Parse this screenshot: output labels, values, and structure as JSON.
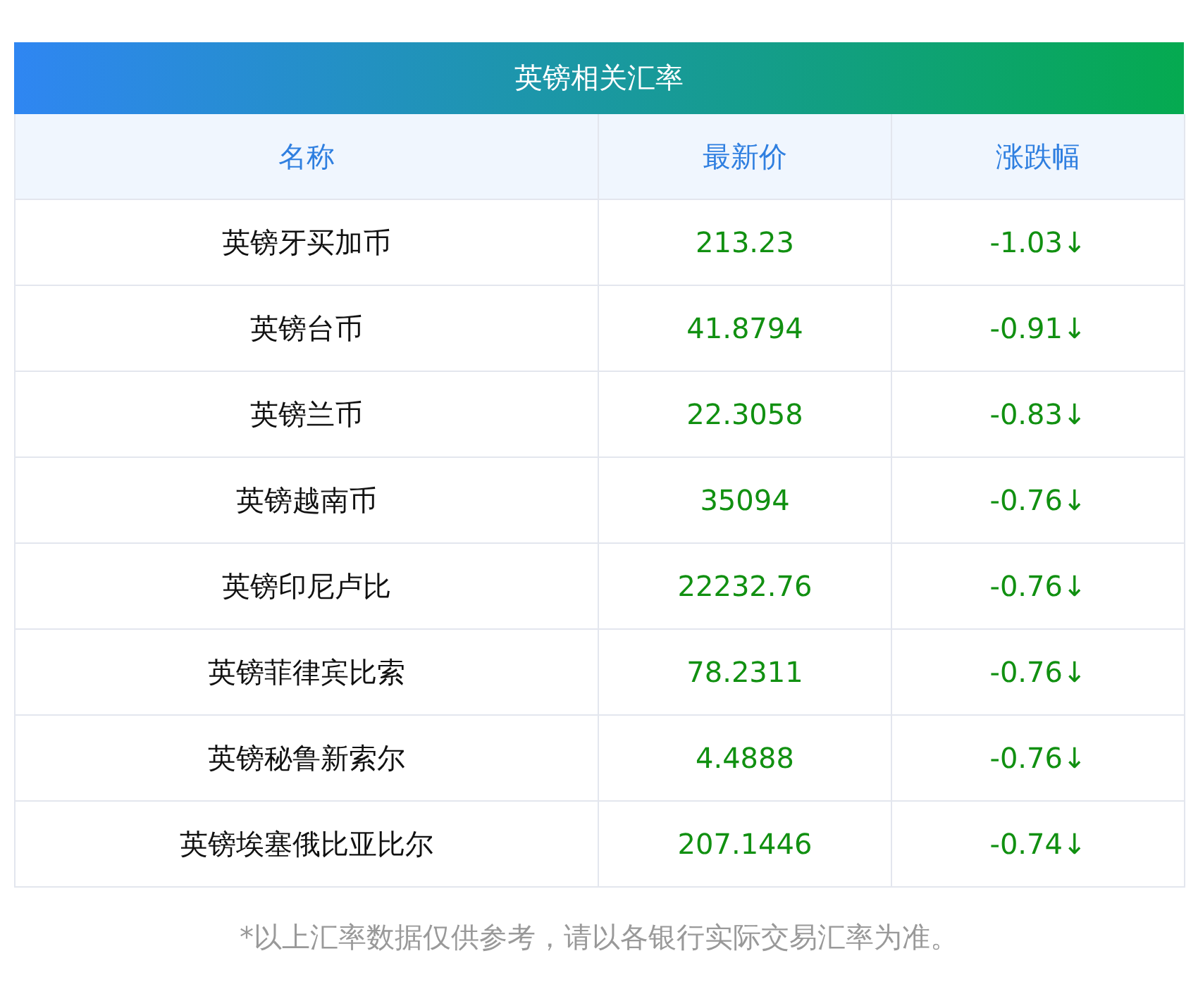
{
  "title": "英镑相关汇率",
  "columns": [
    "名称",
    "最新价",
    "涨跌幅"
  ],
  "rows": [
    {
      "name": "英镑牙买加币",
      "price": "213.23",
      "change": "-1.03↓"
    },
    {
      "name": "英镑台币",
      "price": "41.8794",
      "change": "-0.91↓"
    },
    {
      "name": "英镑兰币",
      "price": "22.3058",
      "change": "-0.83↓"
    },
    {
      "name": "英镑越南币",
      "price": "35094",
      "change": "-0.76↓"
    },
    {
      "name": "英镑印尼卢比",
      "price": "22232.76",
      "change": "-0.76↓"
    },
    {
      "name": "英镑菲律宾比索",
      "price": "78.2311",
      "change": "-0.76↓"
    },
    {
      "name": "英镑秘鲁新索尔",
      "price": "4.4888",
      "change": "-0.76↓"
    },
    {
      "name": "英镑埃塞俄比亚比尔",
      "price": "207.1446",
      "change": "-0.74↓"
    }
  ],
  "footnote": "*以上汇率数据仅供参考，请以各银行实际交易汇率为准。"
}
